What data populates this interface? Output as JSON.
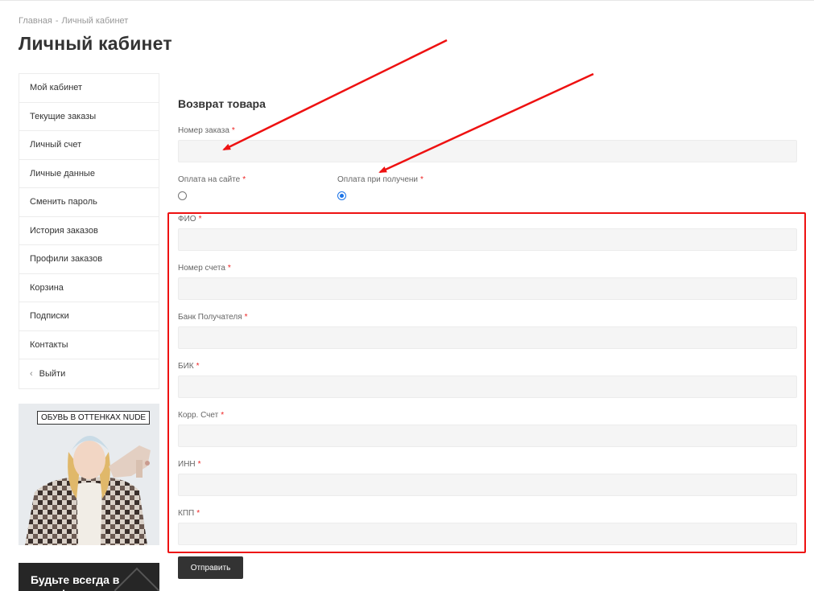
{
  "breadcrumb": {
    "home": "Главная",
    "separator": "-",
    "current": "Личный кабинет"
  },
  "page": {
    "title": "Личный кабинет"
  },
  "sidebar": {
    "items": [
      {
        "label": "Мой кабинет"
      },
      {
        "label": "Текущие заказы"
      },
      {
        "label": "Личный счет"
      },
      {
        "label": "Личные данные"
      },
      {
        "label": "Сменить пароль"
      },
      {
        "label": "История заказов"
      },
      {
        "label": "Профили заказов"
      },
      {
        "label": "Корзина"
      },
      {
        "label": "Подписки"
      },
      {
        "label": "Контакты"
      },
      {
        "label": "Выйти",
        "icon": "chevron-left-icon"
      }
    ]
  },
  "promo": {
    "tag": "ОБУВЬ В ОТТЕНКАХ NUDE"
  },
  "banner": {
    "text": "Будьте всегда в курсе!"
  },
  "form": {
    "title": "Возврат товара",
    "required_mark": "*",
    "order_number": {
      "label": "Номер заказа",
      "value": ""
    },
    "payment": {
      "site": {
        "label": "Оплата на сайте",
        "checked": false
      },
      "on_delivery": {
        "label": "Оплата при получени",
        "checked": true
      }
    },
    "fields": [
      {
        "label": "ФИО",
        "value": ""
      },
      {
        "label": "Номер счета",
        "value": ""
      },
      {
        "label": "Банк Получателя",
        "value": ""
      },
      {
        "label": "БИК",
        "value": ""
      },
      {
        "label": "Корр. Счет",
        "value": ""
      },
      {
        "label": "ИНН",
        "value": ""
      },
      {
        "label": "КПП",
        "value": ""
      }
    ],
    "submit_label": "Отправить"
  },
  "colors": {
    "annotation": "#e11111",
    "radio_checked": "#1a73e8",
    "button_bg": "#333333",
    "banner_bg": "#262626",
    "required": "#ee2222"
  }
}
